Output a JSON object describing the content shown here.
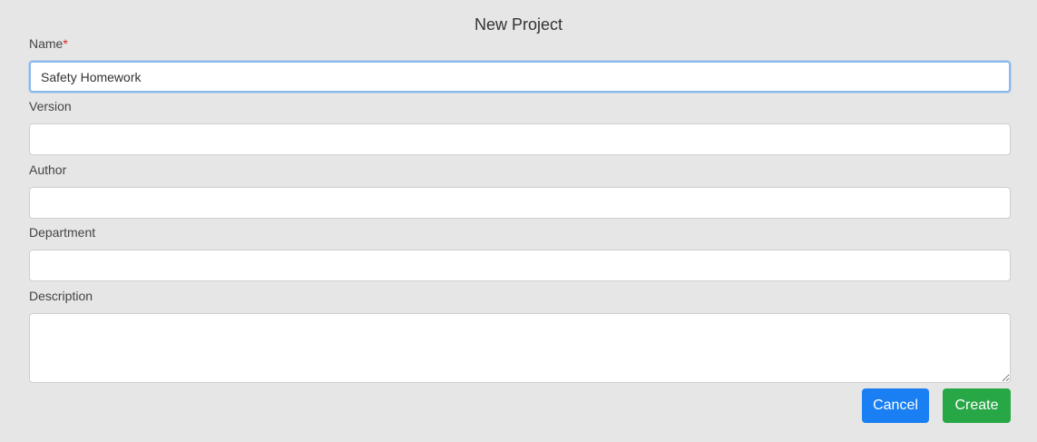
{
  "dialog": {
    "title": "New Project"
  },
  "form": {
    "name": {
      "label": "Name",
      "required_marker": "*",
      "value": "Safety Homework"
    },
    "version": {
      "label": "Version",
      "value": ""
    },
    "author": {
      "label": "Author",
      "value": ""
    },
    "department": {
      "label": "Department",
      "value": ""
    },
    "description": {
      "label": "Description",
      "value": ""
    }
  },
  "actions": {
    "cancel_label": "Cancel",
    "create_label": "Create"
  },
  "colors": {
    "background": "#e6e6e6",
    "cancel_button": "#1a7ff2",
    "create_button": "#27a745",
    "required": "#e02424",
    "focus_border": "#8ab9ef"
  }
}
